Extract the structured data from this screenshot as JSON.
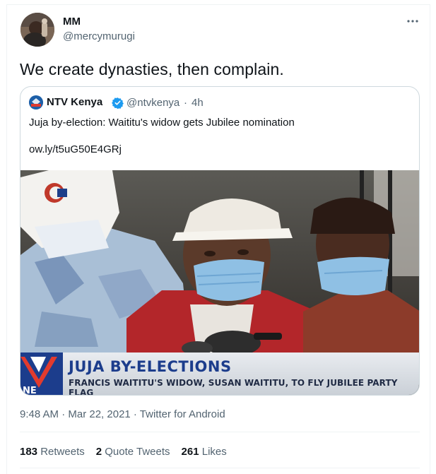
{
  "tweet": {
    "author_name": "MM",
    "author_handle": "@mercymurugi",
    "text": "We create dynasties, then complain.",
    "more_icon": "more-horizontal-icon",
    "avatar_icon": "user-avatar"
  },
  "quoted_tweet": {
    "author_name": "NTV Kenya",
    "author_handle": "@ntvkenya",
    "separator": "·",
    "time": "4h",
    "verified_icon": "verified-badge-icon",
    "text": "Juja by-election: Waititu's widow gets Jubilee nomination",
    "link": "ow.ly/t5uG50E4GRj",
    "media": {
      "banner_title": "JUJA BY-ELECTIONS",
      "banner_subtitle": "FRANCIS WAITITU'S WIDOW, SUSAN WAITITU, TO FLY JUBILEE PARTY FLAG",
      "logo_text": "NE"
    }
  },
  "meta": {
    "timestamp": "9:48 AM · Mar 22, 2021 · Twitter for Android"
  },
  "stats": {
    "retweets_count": "183",
    "retweets_label": "Retweets",
    "quotes_count": "2",
    "quotes_label": "Quote Tweets",
    "likes_count": "261",
    "likes_label": "Likes"
  },
  "colors": {
    "link_blue": "#1d9bf0",
    "secondary_text": "#536471",
    "banner_blue": "#1c3d8c"
  }
}
